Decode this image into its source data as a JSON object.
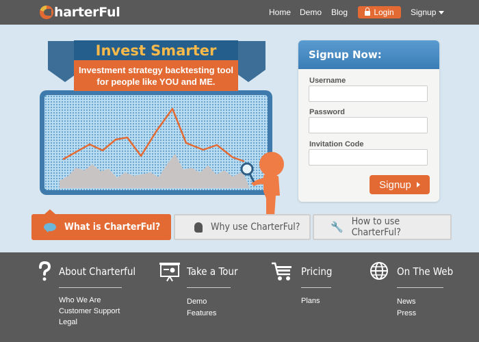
{
  "header": {
    "logo_text": "harterFul",
    "nav": {
      "home": "Home",
      "demo": "Demo",
      "blog": "Blog",
      "login": "Login",
      "signup": "Signup"
    }
  },
  "hero": {
    "title": "Invest Smarter",
    "subtitle_line1": "Investment strategy backtesting tool",
    "subtitle_line2": "for people like YOU and ME."
  },
  "signup_form": {
    "title": "Signup Now:",
    "username_label": "Username",
    "password_label": "Password",
    "invitation_label": "Invitation Code",
    "username_value": "",
    "password_value": "",
    "invitation_value": "",
    "submit_label": "Signup"
  },
  "tabs": [
    {
      "label": "What is CharterFul?",
      "active": true
    },
    {
      "label": "Why use CharterFul?",
      "active": false
    },
    {
      "label": "How to use CharterFul?",
      "active": false
    }
  ],
  "footer": {
    "columns": [
      {
        "heading": "About Charterful",
        "icon": "question-icon",
        "links": [
          "Who We Are",
          "Customer Support",
          "Legal"
        ]
      },
      {
        "heading": "Take a Tour",
        "icon": "presentation-icon",
        "links": [
          "Demo",
          "Features"
        ]
      },
      {
        "heading": "Pricing",
        "icon": "cart-icon",
        "links": [
          "Plans"
        ]
      },
      {
        "heading": "On The Web",
        "icon": "globe-icon",
        "links": [
          "News",
          "Press"
        ]
      }
    ]
  },
  "colors": {
    "accent": "#e36a33",
    "nav_bg": "#595959",
    "page_bg": "#d7e6f0",
    "ribbon_blue": "#235e8c",
    "title_gold": "#f7b94a"
  }
}
